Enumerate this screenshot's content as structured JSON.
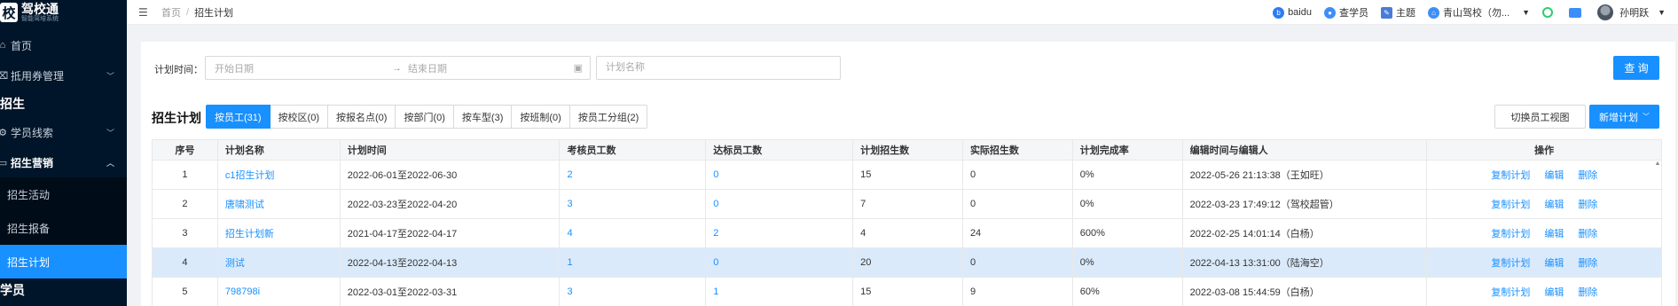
{
  "sidebar": {
    "logo_badge": "校",
    "logo_title": "驾校通",
    "logo_sub": "智能驾培系统",
    "items": [
      {
        "label": "首页",
        "icon": "home-icon"
      },
      {
        "label": "抵用券管理",
        "icon": "coupon-icon"
      }
    ],
    "group_enroll": "招生",
    "enroll_items": [
      {
        "label": "学员线索",
        "icon": "setting-icon"
      },
      {
        "label": "招生营销",
        "icon": "folder-icon"
      }
    ],
    "submenu": [
      {
        "label": "招生活动"
      },
      {
        "label": "招生报备"
      },
      {
        "label": "招生计划"
      }
    ],
    "group_student": "学员"
  },
  "topbar": {
    "breadcrumb": [
      "首页",
      "招生计划"
    ],
    "right": [
      {
        "label": "baidu",
        "icon": "baidu-icon",
        "color": "#2b7cf6"
      },
      {
        "label": "查学员",
        "icon": "search-user-icon",
        "color": "#3d8ef8"
      },
      {
        "label": "主题",
        "icon": "theme-icon",
        "color": "#4a7bd8"
      },
      {
        "label": "青山驾校（勿...",
        "icon": "school-icon",
        "color": "#3d8ef8"
      },
      {
        "label": "",
        "icon": "refresh-icon",
        "color": "#2ecc71"
      },
      {
        "label": "",
        "icon": "screen-icon",
        "color": "#3d8ef8"
      }
    ],
    "user": "孙明跃"
  },
  "filter": {
    "label": "计划时间：",
    "start_placeholder": "开始日期",
    "end_placeholder": "结束日期",
    "name_placeholder": "计划名称",
    "query": "查 询"
  },
  "plan": {
    "title": "招生计划",
    "tabs": [
      "按员工(31)",
      "按校区(0)",
      "按报名点(0)",
      "按部门(0)",
      "按车型(3)",
      "按班制(0)",
      "按员工分组(2)"
    ],
    "switch_view": "切换员工视图",
    "new_plan": "新增计划"
  },
  "table": {
    "headers": [
      "序号",
      "计划名称",
      "计划时间",
      "考核员工数",
      "达标员工数",
      "计划招生数",
      "实际招生数",
      "计划完成率",
      "编辑时间与编辑人",
      "操作"
    ],
    "rows": [
      [
        "1",
        "c1招生计划",
        "2022-06-01至2022-06-30",
        "2",
        "0",
        "15",
        "0",
        "0%",
        "2022-05-26 21:13:38（王如旺）"
      ],
      [
        "2",
        "唐啸测试",
        "2022-03-23至2022-04-20",
        "3",
        "0",
        "7",
        "0",
        "0%",
        "2022-03-23 17:49:12（驾校超管）"
      ],
      [
        "3",
        "招生计划新",
        "2021-04-17至2022-04-17",
        "4",
        "2",
        "4",
        "24",
        "600%",
        "2022-02-25 14:01:14（白杨）"
      ],
      [
        "4",
        "测试",
        "2022-04-13至2022-04-13",
        "1",
        "0",
        "20",
        "0",
        "0%",
        "2022-04-13 13:31:00（陆海空）"
      ],
      [
        "5",
        "798798i",
        "2022-03-01至2022-03-31",
        "3",
        "1",
        "15",
        "9",
        "60%",
        "2022-03-08 15:44:59（白杨）"
      ]
    ],
    "ops": [
      "复制计划",
      "编辑",
      "删除"
    ]
  }
}
